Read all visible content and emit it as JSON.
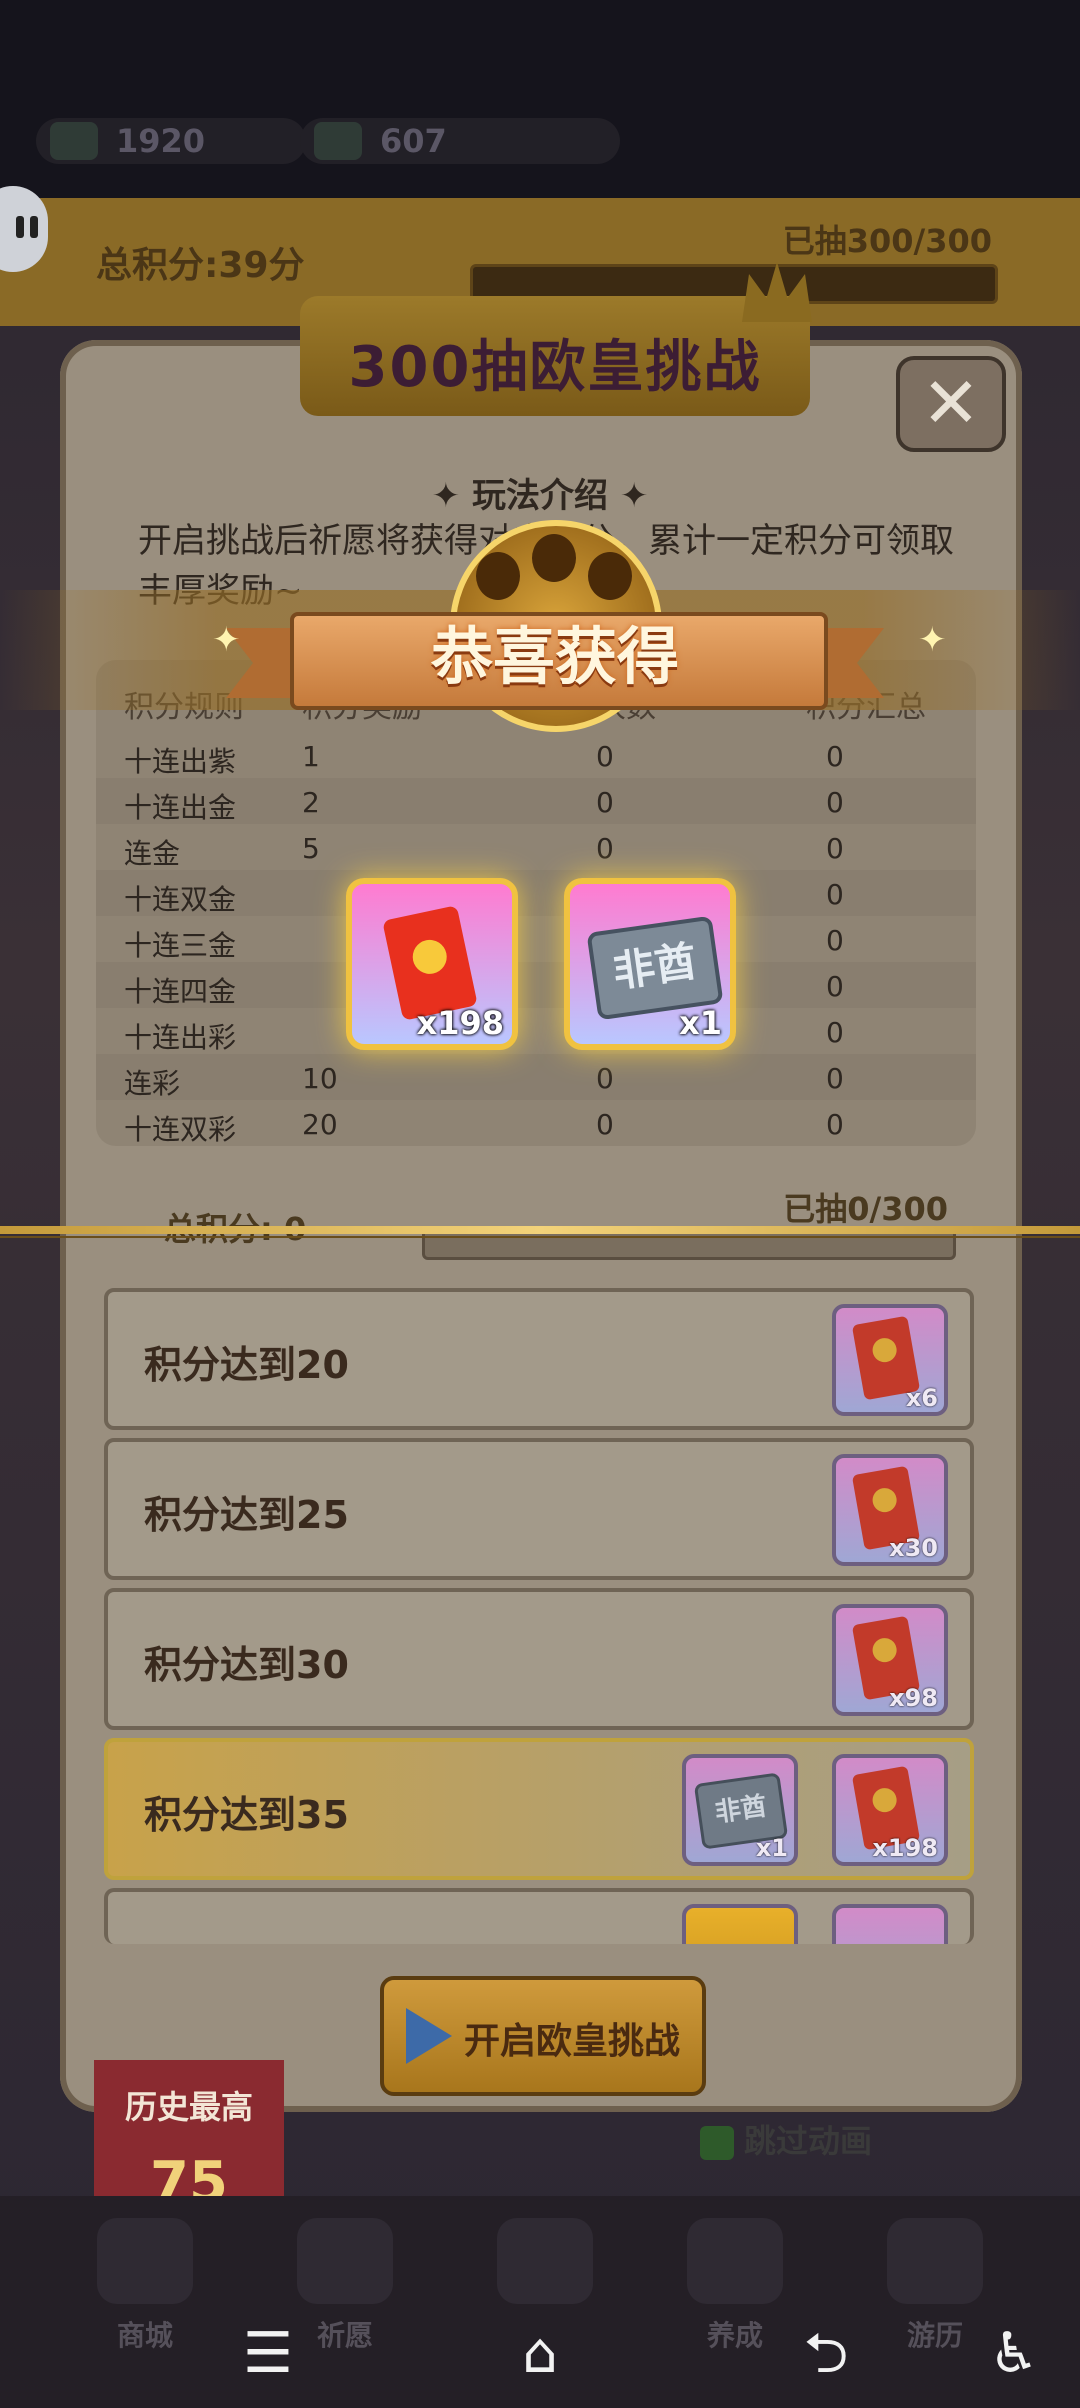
{
  "resources": [
    {
      "icon": "gem-icon",
      "value": "1920"
    },
    {
      "icon": "ticket-icon",
      "value": "607"
    }
  ],
  "score_bar": {
    "label": "总积分:39分",
    "count": "已抽300/300"
  },
  "modal": {
    "title": "300抽欧皇挑战",
    "close": "✕",
    "howto": "✦ 玩法介绍 ✦",
    "description": "开启挑战后祈愿将获得对应积分，累计一定积分可领取丰厚奖励~",
    "table": {
      "headers": [
        "积分规则",
        "积分奖励",
        "次数",
        "积分汇总"
      ],
      "rows": [
        [
          "十连出紫",
          "1",
          "0",
          "0"
        ],
        [
          "十连出金",
          "2",
          "0",
          "0"
        ],
        [
          "连金",
          "5",
          "0",
          "0"
        ],
        [
          "十连双金",
          "",
          "",
          "0"
        ],
        [
          "十连三金",
          "",
          "",
          "0"
        ],
        [
          "十连四金",
          "",
          "",
          "0"
        ],
        [
          "十连出彩",
          "",
          "",
          "0"
        ],
        [
          "连彩",
          "10",
          "0",
          "0"
        ],
        [
          "十连双彩",
          "20",
          "0",
          "0"
        ]
      ]
    },
    "progress": {
      "label": "总积分: 0",
      "count": "已抽0/300"
    },
    "milestones": [
      {
        "label": "积分达到20",
        "rewards": [
          {
            "type": "red-packet",
            "qty": "x6"
          }
        ]
      },
      {
        "label": "积分达到25",
        "rewards": [
          {
            "type": "red-packet",
            "qty": "x30"
          }
        ]
      },
      {
        "label": "积分达到30",
        "rewards": [
          {
            "type": "red-packet",
            "qty": "x98"
          }
        ]
      },
      {
        "label": "积分达到35",
        "rewards": [
          {
            "type": "plaque",
            "text": "非酋",
            "qty": "x1"
          },
          {
            "type": "red-packet",
            "qty": "x198"
          }
        ]
      },
      {
        "label": "",
        "rewards": []
      }
    ],
    "start_button": "开启欧皇挑战"
  },
  "reward_popup": {
    "title": "恭喜获得",
    "items": [
      {
        "type": "red-packet",
        "qty": "x198"
      },
      {
        "type": "plaque",
        "text": "非酋",
        "qty": "x1"
      }
    ]
  },
  "history": {
    "label": "历史最高",
    "value": "75"
  },
  "skip_animation": "跳过动画",
  "game_nav": [
    "商城",
    "祈愿",
    "",
    "养成",
    "游历"
  ],
  "system_nav": {
    "menu": "☰",
    "home": "⌂",
    "back": "⮌",
    "accessibility": "♿"
  },
  "colors": {
    "gold": "#f0c240",
    "modal_bg": "#9a8f7f",
    "title_text": "#3c1d34"
  }
}
